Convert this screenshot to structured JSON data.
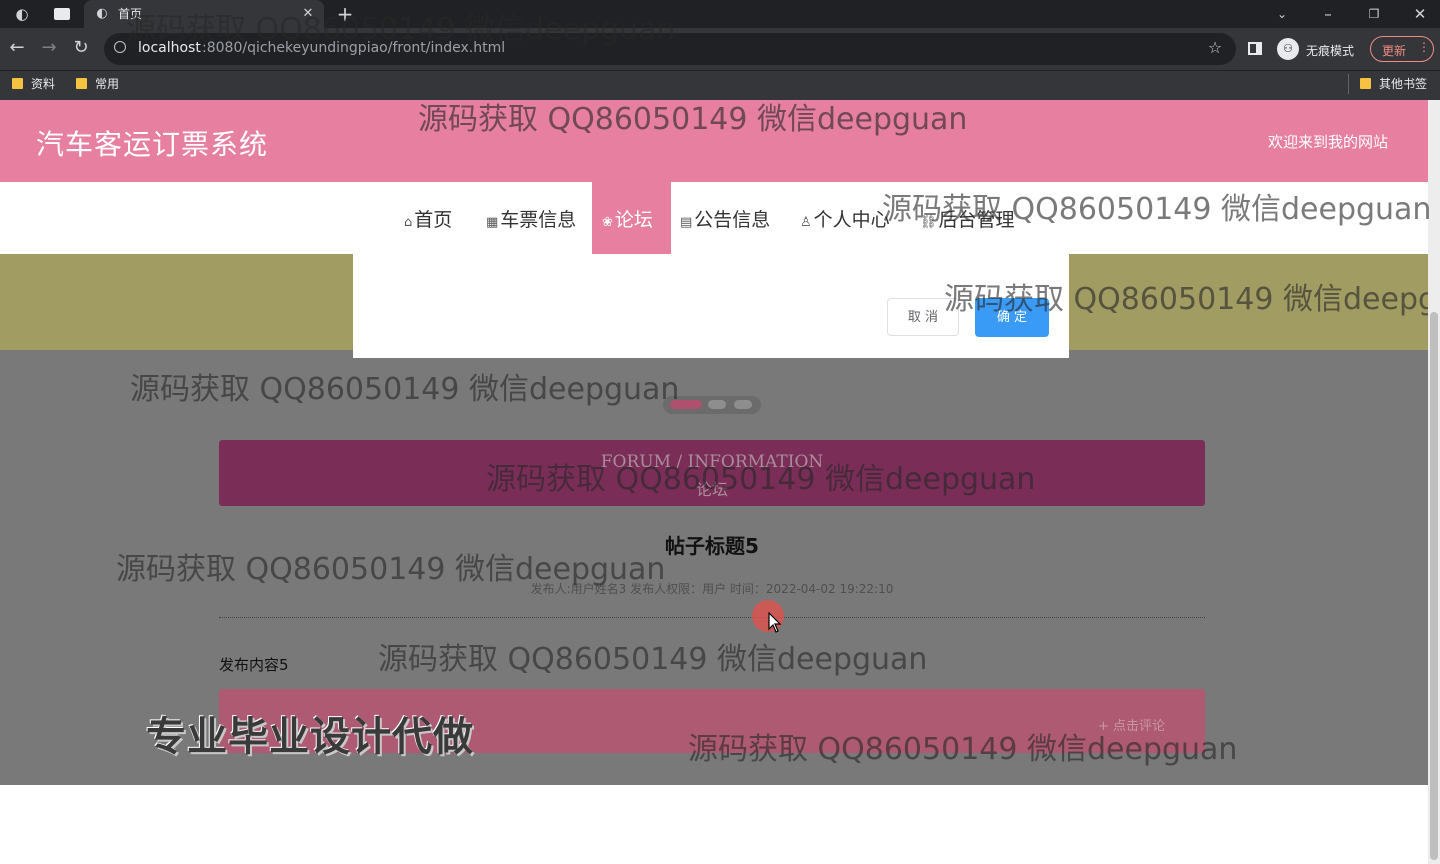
{
  "browser": {
    "tab_title": "首页",
    "url_host": "localhost",
    "url_path": ":8080/qichekeyundingpiao/front/index.html",
    "incognito_label": "无痕模式",
    "update_label": "更新",
    "bookmarks": [
      "资料",
      "常用"
    ],
    "other_bookmarks": "其他书签"
  },
  "site": {
    "title": "汽车客运订票系统",
    "welcome": "欢迎来到我的网站"
  },
  "nav": [
    {
      "icon": "⌂",
      "label": "首页"
    },
    {
      "icon": "▦",
      "label": "车票信息"
    },
    {
      "icon": "❀",
      "label": "论坛"
    },
    {
      "icon": "▤",
      "label": "公告信息"
    },
    {
      "icon": "♙",
      "label": "个人中心"
    },
    {
      "icon": "⛓",
      "label": "后台管理"
    }
  ],
  "modal": {
    "cancel": "取 消",
    "confirm": "确 定"
  },
  "forum": {
    "heading_en": "FORUM / INFORMATION",
    "heading_cn": "论坛",
    "post_title": "帖子标题5",
    "meta": "发布人:用户姓名3   发布人权限：用户   时间：2022-04-02 19:22:10",
    "content": "发布内容5",
    "comment_button": "+ 点击评论"
  },
  "watermark": "源码获取 QQ86050149 微信deepguan",
  "promo": "专业毕业设计代做",
  "colors": {
    "header": "#e77fa1",
    "forum_bar": "#7a2e57",
    "confirm": "#3a9bf6"
  }
}
